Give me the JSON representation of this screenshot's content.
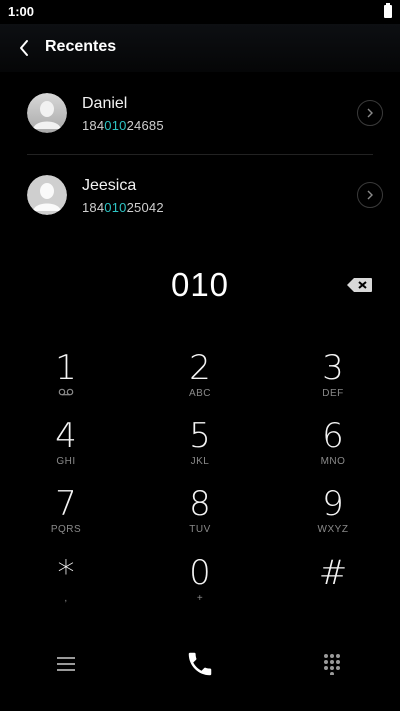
{
  "status_bar": {
    "time": "1:00"
  },
  "app_bar": {
    "title": "Recentes"
  },
  "contacts": [
    {
      "name": "Daniel",
      "number_prefix": "184",
      "number_match": "010",
      "number_suffix": "24685"
    },
    {
      "name": "Jeesica",
      "number_prefix": "184",
      "number_match": "010",
      "number_suffix": "25042"
    }
  ],
  "dialed_number": "010",
  "keypad": [
    {
      "digit": "1",
      "letters": ""
    },
    {
      "digit": "2",
      "letters": "ABC"
    },
    {
      "digit": "3",
      "letters": "DEF"
    },
    {
      "digit": "4",
      "letters": "GHI"
    },
    {
      "digit": "5",
      "letters": "JKL"
    },
    {
      "digit": "6",
      "letters": "MNO"
    },
    {
      "digit": "7",
      "letters": "PQRS"
    },
    {
      "digit": "8",
      "letters": "TUV"
    },
    {
      "digit": "9",
      "letters": "WXYZ"
    },
    {
      "digit": "*",
      "letters": ","
    },
    {
      "digit": "0",
      "letters": "+"
    },
    {
      "digit": "#",
      "letters": ""
    }
  ],
  "icons": {
    "back": "chevron-left-icon",
    "battery": "battery-icon",
    "detail": "chevron-right-icon",
    "backspace": "backspace-icon",
    "voicemail": "voicemail-icon",
    "menu": "menu-icon",
    "call": "phone-icon",
    "dialpad": "dialpad-icon"
  },
  "colors": {
    "highlight": "#2ec4c4",
    "background": "#000000"
  }
}
